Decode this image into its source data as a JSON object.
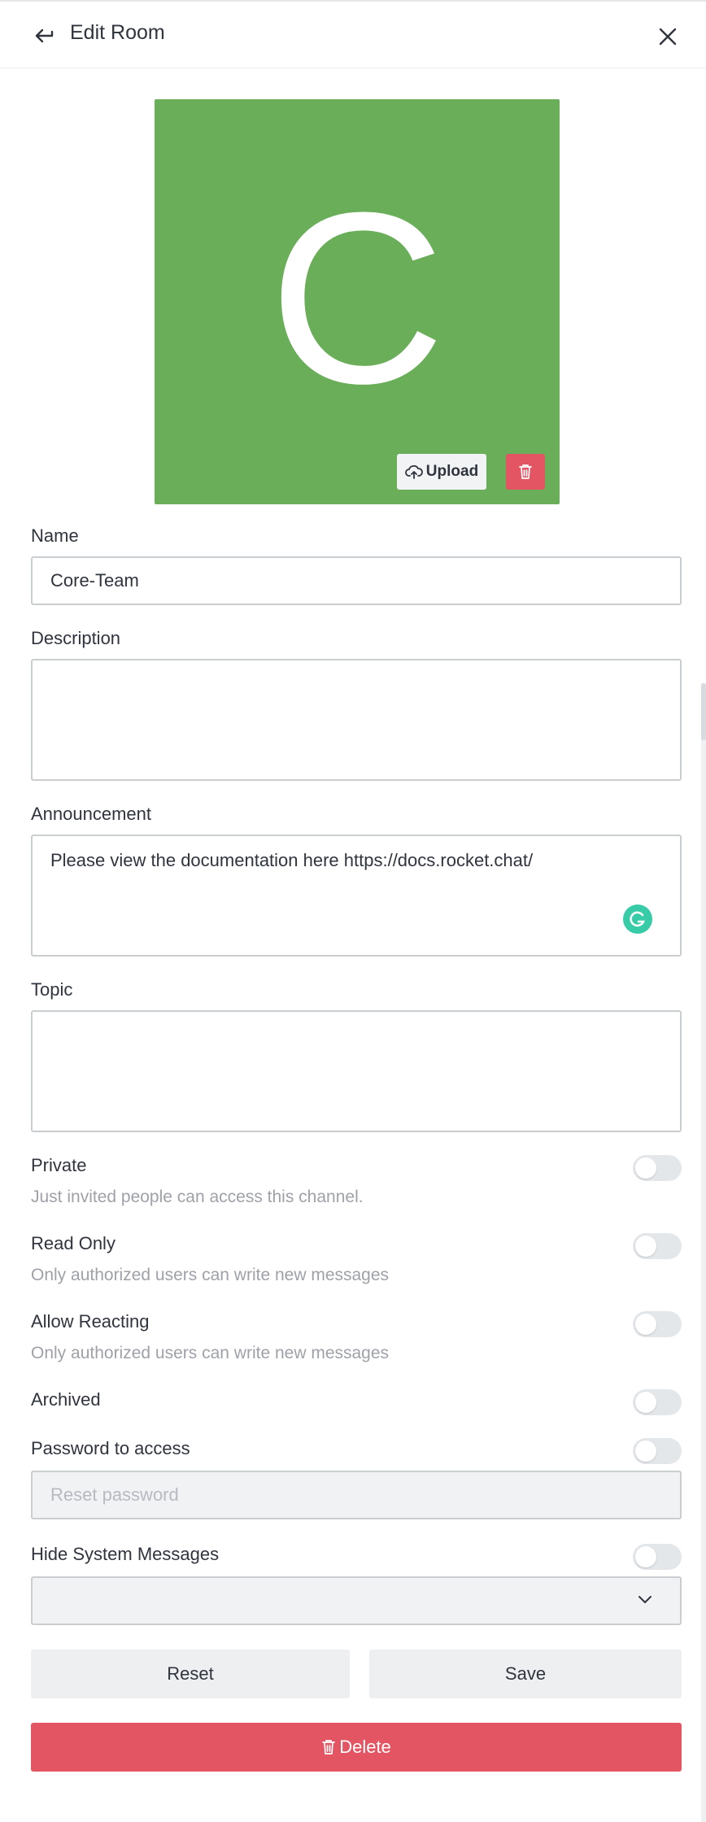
{
  "header": {
    "title": "Edit Room"
  },
  "avatar": {
    "letter": "C",
    "color": "#6aae5a",
    "upload_label": "Upload"
  },
  "form": {
    "name": {
      "label": "Name",
      "value": "Core-Team"
    },
    "description": {
      "label": "Description",
      "value": ""
    },
    "announcement": {
      "label": "Announcement",
      "value": "Please view the documentation here https://docs.rocket.chat/"
    },
    "topic": {
      "label": "Topic",
      "value": ""
    },
    "private": {
      "label": "Private",
      "hint": "Just invited people can access this channel.",
      "on": false
    },
    "read_only": {
      "label": "Read Only",
      "hint": "Only authorized users can write new messages",
      "on": false
    },
    "allow_reacting": {
      "label": "Allow Reacting",
      "hint": "Only authorized users can write new messages",
      "on": false
    },
    "archived": {
      "label": "Archived",
      "on": false
    },
    "password": {
      "label": "Password to access",
      "placeholder": "Reset password",
      "on": false
    },
    "hide_system_messages": {
      "label": "Hide System Messages",
      "on": false,
      "selected": ""
    }
  },
  "actions": {
    "reset": "Reset",
    "save": "Save",
    "delete": "Delete"
  },
  "colors": {
    "danger": "#e45563",
    "accent": "#15c39a"
  }
}
